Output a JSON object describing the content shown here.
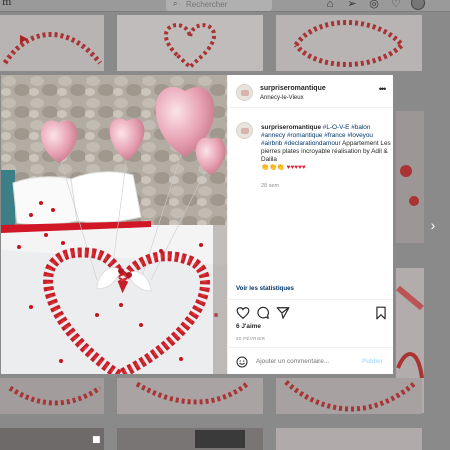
{
  "topnav": {
    "brand": "m",
    "search_placeholder": "Rechercher",
    "search_icon": "magnifier-icon",
    "icons": [
      "home-icon",
      "direct-icon",
      "explore-icon",
      "activity-icon"
    ]
  },
  "post": {
    "username": "surpriseromantique",
    "location": "Annecy-le-Vieux",
    "more_icon": "ellipsis-icon",
    "caption": {
      "username": "surpriseromantique",
      "tags_line": [
        "#L-O-V-E",
        "#balon",
        "#annecy",
        "#romantique",
        "#france",
        "#loveyou",
        "#airbnb",
        "#declarationdamour"
      ],
      "text": "Appartement Les pierres plates incroyable réalisation by Adil & Dalila",
      "emoji_line": "👏👏👏",
      "hearts": "♥♥♥♥♥",
      "time": "28 sem"
    },
    "stats_link": "Voir les statistiques",
    "likes": "6 J'aime",
    "date": "20 FÉVRIER",
    "comment_placeholder": "Ajouter un commentaire...",
    "publish_label": "Publier"
  },
  "colors": {
    "link": "#00376b",
    "petal_red": "#c4141f",
    "balloon_pink": "#e9a6b5",
    "publish_disabled": "#b2dffc"
  },
  "next_icon": "chevron-right-icon"
}
